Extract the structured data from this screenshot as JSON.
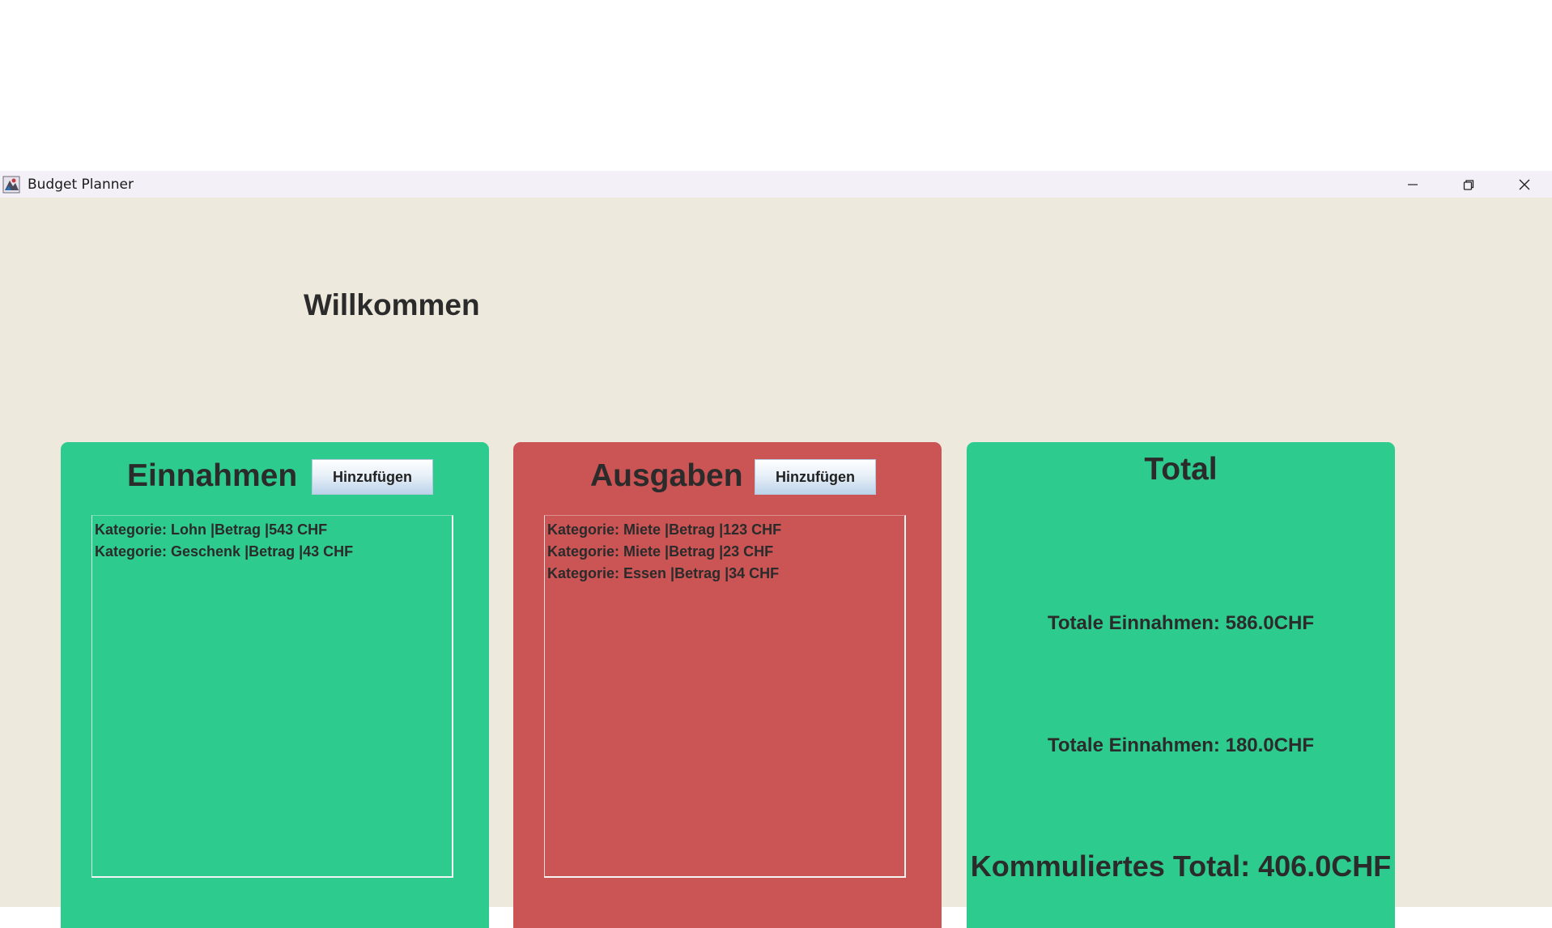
{
  "window": {
    "title": "Budget Planner",
    "icons": [
      "app-icon",
      "minimize-icon",
      "restore-icon",
      "close-icon"
    ]
  },
  "main": {
    "welcome": "Willkommen"
  },
  "income": {
    "title": "Einnahmen",
    "add_label": "Hinzufügen",
    "items": [
      "Kategorie: Lohn |Betrag |543 CHF",
      "Kategorie: Geschenk |Betrag |43 CHF"
    ]
  },
  "expenses": {
    "title": "Ausgaben",
    "add_label": "Hinzufügen",
    "items": [
      "Kategorie: Miete |Betrag |123 CHF",
      "Kategorie: Miete |Betrag |23 CHF",
      "Kategorie: Essen |Betrag |34 CHF"
    ]
  },
  "total": {
    "title": "Total",
    "income_line": "Totale Einnahmen: 586.0CHF",
    "expense_line": "Totale Einnahmen: 180.0CHF",
    "cumulative_line": "Kommuliertes Total: 406.0CHF"
  },
  "colors": {
    "income_panel": "#2ecb8f",
    "expense_panel": "#cb5455",
    "total_panel": "#2ecb8f",
    "background": "#ede9dd",
    "titlebar": "#f3f0f7"
  }
}
